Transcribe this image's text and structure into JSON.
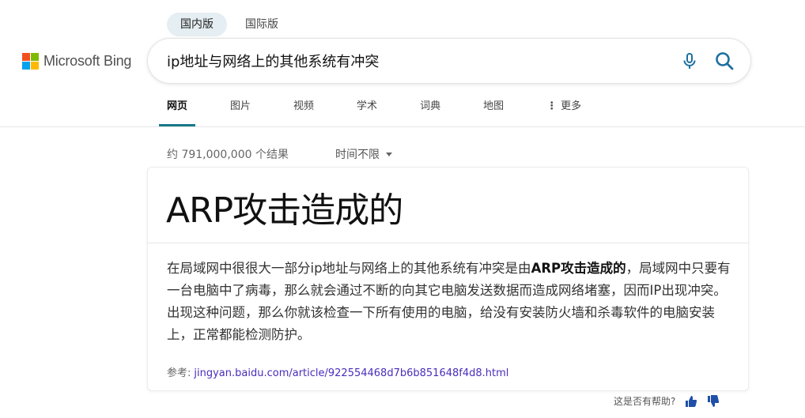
{
  "colors": {
    "accent": "#17788a",
    "link": "#4a2dbc",
    "icon_blue": "#1d6f9e"
  },
  "logo": {
    "text": "Microsoft Bing",
    "squares": [
      "#f25022",
      "#7fba00",
      "#00a4ef",
      "#ffb900"
    ]
  },
  "market": {
    "domestic": "国内版",
    "international": "国际版",
    "selected": "domestic"
  },
  "search": {
    "query": "ip地址与网络上的其他系统有冲突",
    "mic_icon": "microphone-icon",
    "search_icon": "search-icon"
  },
  "scopes": [
    {
      "label": "网页",
      "active": true
    },
    {
      "label": "图片",
      "active": false
    },
    {
      "label": "视频",
      "active": false
    },
    {
      "label": "学术",
      "active": false
    },
    {
      "label": "词典",
      "active": false
    },
    {
      "label": "地图",
      "active": false
    },
    {
      "label": "更多",
      "active": false,
      "icon": "more-vertical-icon"
    }
  ],
  "results": {
    "count_text": "约 791,000,000 个结果",
    "time_filter": "时间不限"
  },
  "answer": {
    "headline": "ARP攻击造成的",
    "desc_pre": "在局域网中很很大一部分ip地址与网络上的其他系统有冲突是由",
    "desc_bold": "ARP攻击造成的",
    "desc_post": "，局域网中只要有一台电脑中了病毒，那么就会通过不断的向其它电脑发送数据而造成网络堵塞，因而IP出现冲突。 出现这种问题，那么你就该检查一下所有使用的电脑，给没有安装防火墙和杀毒软件的电脑安装上，正常都能检测防护。",
    "ref_label": "参考:",
    "ref_url": "jingyan.baidu.com/article/922554468d7b6b851648f4d8.html"
  },
  "feedback": {
    "question": "这是否有帮助?",
    "up_icon": "thumbs-up-icon",
    "down_icon": "thumbs-down-icon"
  }
}
